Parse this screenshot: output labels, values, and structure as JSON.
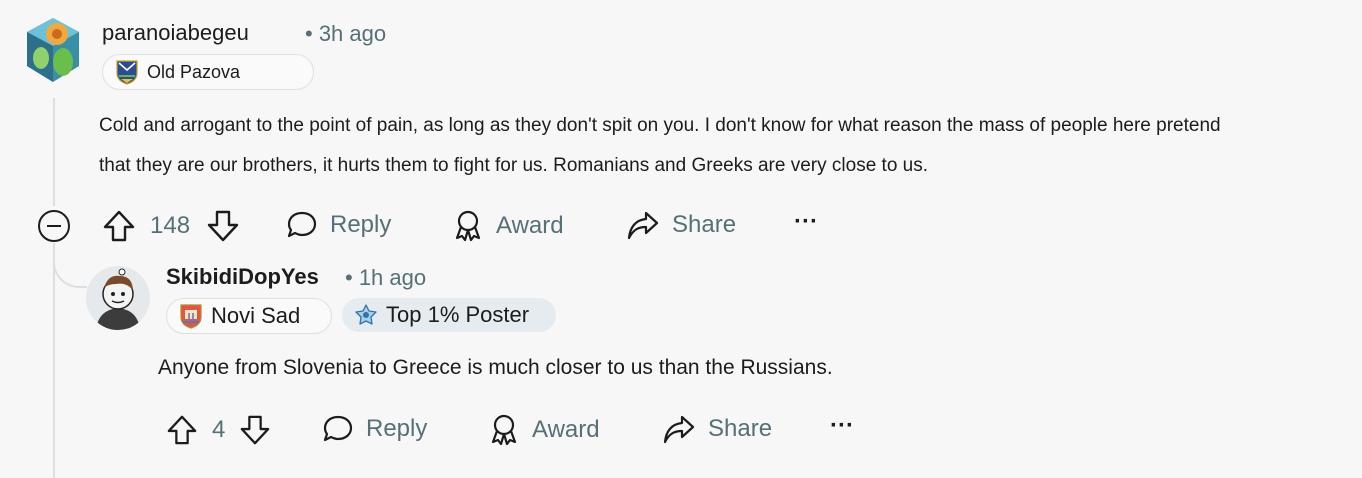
{
  "comments": [
    {
      "username": "paranoiabegeu",
      "time": "• 3h ago",
      "flairs": [
        {
          "text": "Old Pazova",
          "icon": "coat-of-arms-icon"
        }
      ],
      "body_lines": [
        "Cold and arrogant to the point of pain, as long as they don't spit on you. I don't know for what reason the mass of people here pretend",
        "that they are our brothers, it hurts them to fight for us. Romanians and Greeks are very close to us."
      ],
      "votes": "148",
      "actions": {
        "reply": "Reply",
        "award": "Award",
        "share": "Share",
        "more": "···"
      }
    },
    {
      "username": "SkibidiDopYes",
      "time": "• 1h ago",
      "flairs": [
        {
          "text": "Novi Sad",
          "icon": "city-crest-icon"
        },
        {
          "text": "Top 1% Poster",
          "icon": "top-poster-icon"
        }
      ],
      "body": "Anyone from Slovenia to Greece is much closer to us than the Russians.",
      "votes": "4",
      "actions": {
        "reply": "Reply",
        "award": "Award",
        "share": "Share",
        "more": "···"
      }
    }
  ],
  "colors": {
    "background": "#f7f7f8",
    "text": "#1c1c1c",
    "muted": "#576f76",
    "thread_line": "#dcdfe2"
  }
}
